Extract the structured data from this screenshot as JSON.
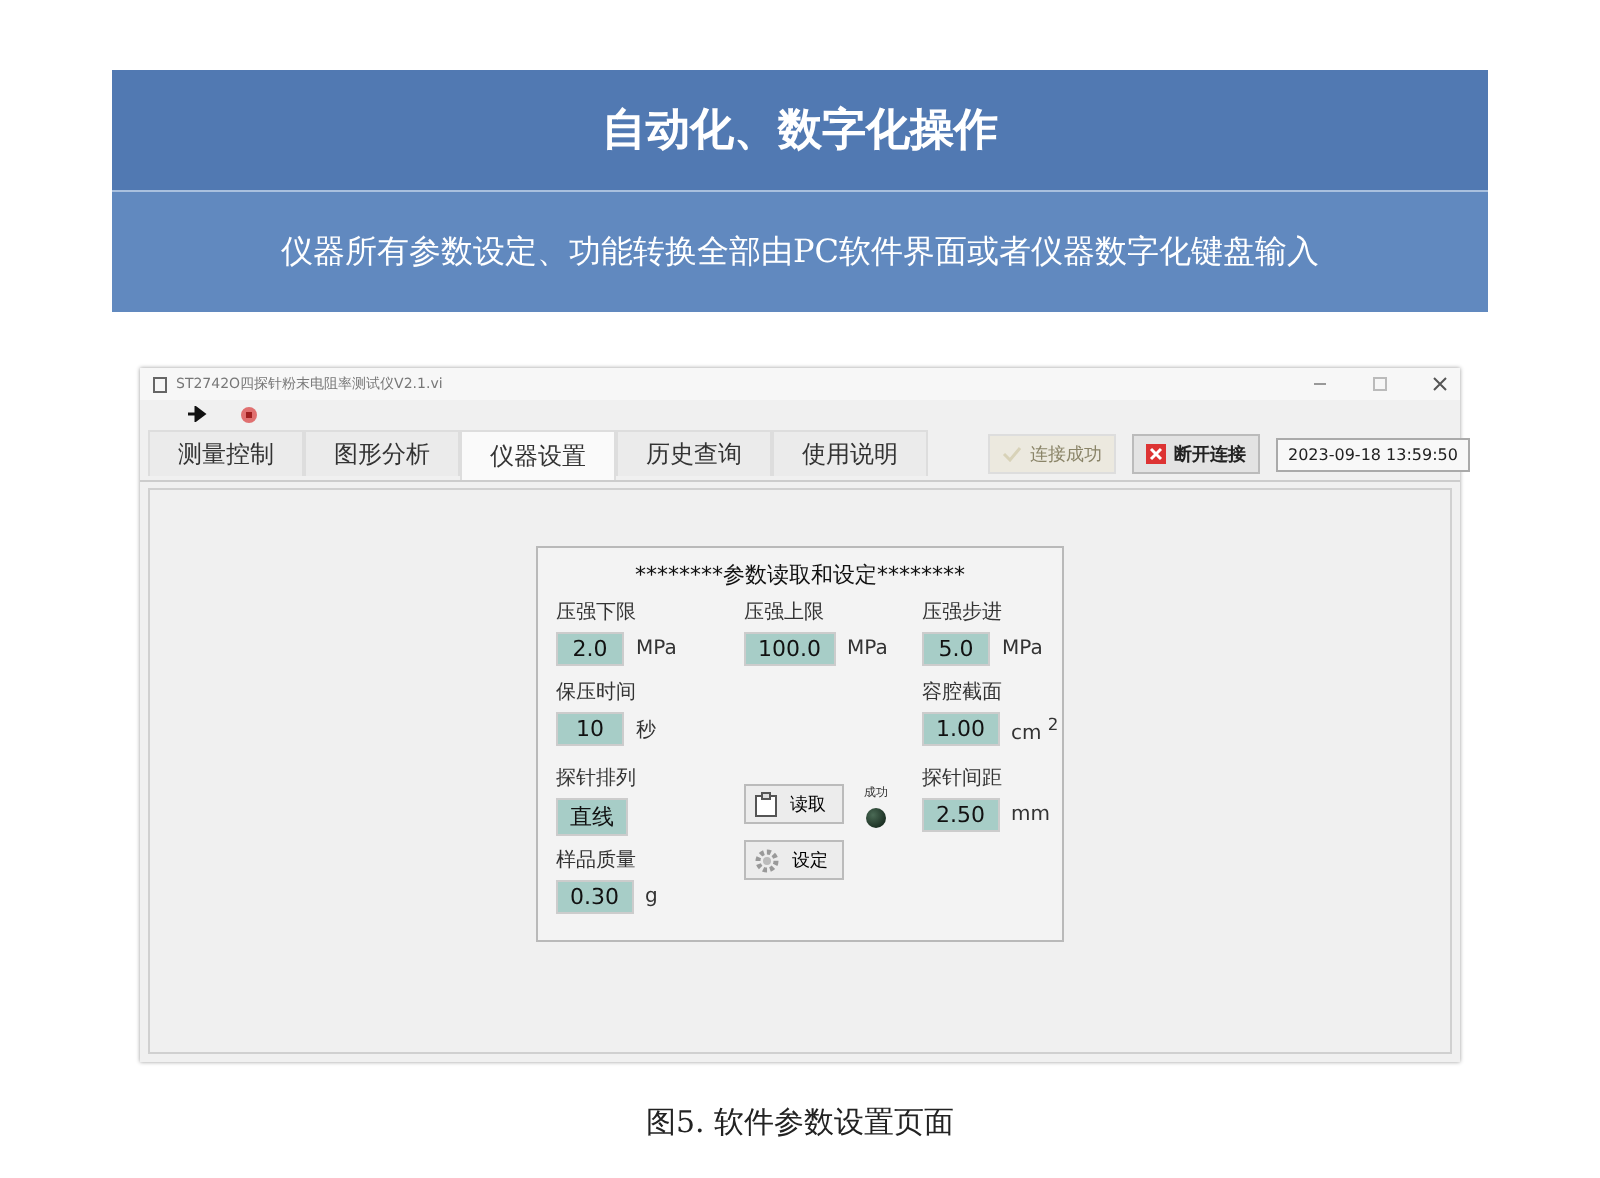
{
  "banner": {
    "title": "自动化、数字化操作",
    "subtitle": "仪器所有参数设定、功能转换全部由PC软件界面或者仪器数字化键盘输入"
  },
  "window": {
    "title": "ST2742O四探针粉末电阻率测试仪V2.1.vi",
    "tabs": [
      {
        "label": "测量控制",
        "selected": false
      },
      {
        "label": "图形分析",
        "selected": false
      },
      {
        "label": "仪器设置",
        "selected": true
      },
      {
        "label": "历史查询",
        "selected": false
      },
      {
        "label": "使用说明",
        "selected": false
      }
    ],
    "connect_status": {
      "label": "连接成功",
      "disabled": true
    },
    "disconnect_button": "断开连接",
    "datetime": "2023-09-18 13:59:50"
  },
  "panel": {
    "title": "********参数读取和设定********",
    "fields": [
      {
        "label": "压强下限",
        "value": "2.0",
        "unit": "MPa"
      },
      {
        "label": "压强上限",
        "value": "100.0",
        "unit": "MPa"
      },
      {
        "label": "压强步进",
        "value": "5.0",
        "unit": "MPa"
      },
      {
        "label": "保压时间",
        "value": "10",
        "unit": "秒"
      },
      {
        "label": "容腔截面",
        "value": "1.00",
        "unit": "cm $^{2}$"
      },
      {
        "label": "探针排列",
        "value": "直线"
      },
      {
        "label": "探针间距",
        "value": "2.50",
        "unit": "mm"
      },
      {
        "label": "样品质量",
        "value": "0.30",
        "unit": "g"
      }
    ],
    "buttons": [
      {
        "label": "读取",
        "kind": "read"
      },
      {
        "label": "设定",
        "kind": "set"
      }
    ],
    "indicator": {
      "label": "成功",
      "on": false
    }
  },
  "caption": "图5. 软件参数设置页面"
}
